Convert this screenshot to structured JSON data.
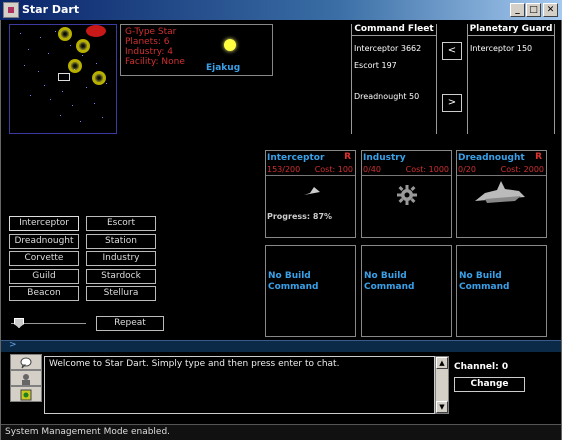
{
  "window": {
    "title": "Star Dart",
    "min_label": "_",
    "max_label": "□",
    "close_label": "✕"
  },
  "star_info": {
    "type": "G-Type Star",
    "planets": "Planets: 6",
    "industry": "Industry: 4",
    "facility": "Facility: None",
    "name": "Ejakug"
  },
  "command_fleet": {
    "title": "Command Fleet",
    "items": [
      "Interceptor 3662",
      "Escort 197",
      "Dreadnought 50"
    ]
  },
  "planetary_guard": {
    "title": "Planetary Guard",
    "items": [
      "Interceptor 150"
    ]
  },
  "transfer": {
    "left_label": "<",
    "right_label": ">"
  },
  "build_cards": [
    {
      "title": "Interceptor",
      "r": "R",
      "count": "153/200",
      "cost": "Cost: 100",
      "progress": "Progress: 87%"
    },
    {
      "title": "Industry",
      "count": "0/40",
      "cost": "Cost: 1000"
    },
    {
      "title": "Dreadnought",
      "r": "R",
      "count": "0/20",
      "cost": "Cost: 2000"
    }
  ],
  "build_commands": [
    "No Build\nCommand",
    "No Build\nCommand",
    "No Build\nCommand"
  ],
  "ship_buttons": [
    "Interceptor",
    "Escort",
    "Dreadnought",
    "Station",
    "Corvette",
    "Industry",
    "Guild",
    "Stardock",
    "Beacon",
    "Stellura"
  ],
  "repeat_label": "Repeat",
  "divider_label": ">",
  "chat": {
    "message": "Welcome to Star Dart. Simply type and then press enter to chat.",
    "channel": "Channel: 0",
    "change_label": "Change"
  },
  "status": "System Management Mode enabled.",
  "colors": {
    "accent_blue": "#3aa0e8",
    "red_text": "#d03030",
    "title_bar": "#0a246a"
  }
}
